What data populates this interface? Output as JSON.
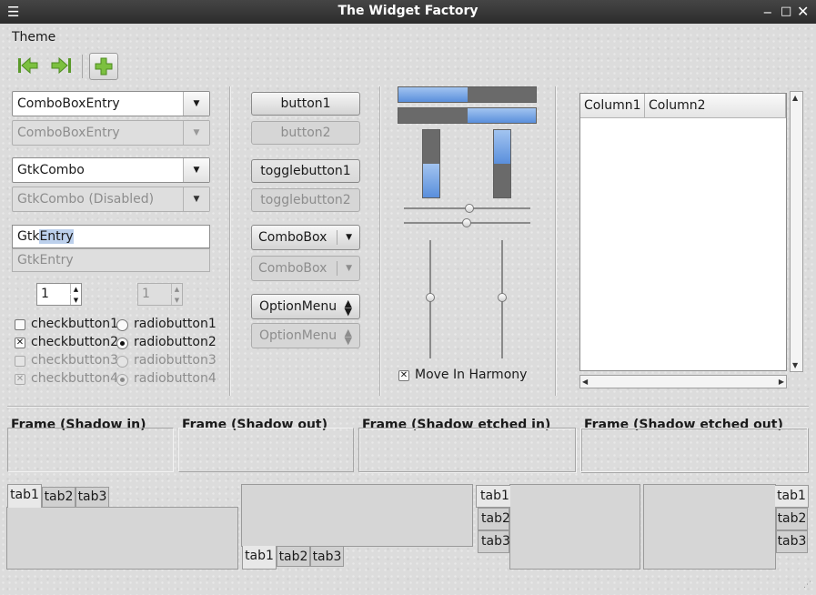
{
  "window": {
    "title": "The Widget Factory"
  },
  "menubar": {
    "theme": "Theme"
  },
  "toolbar": {
    "back_icon": "go-first-icon",
    "forward_icon": "go-last-icon",
    "add_icon": "add-icon"
  },
  "col1": {
    "combo_entry_1": "ComboBoxEntry",
    "combo_entry_2": "ComboBoxEntry",
    "gtk_combo_1": "GtkCombo",
    "gtk_combo_2": "GtkCombo (Disabled)",
    "entry_1_pre": "Gtk",
    "entry_1_sel": "Entry",
    "entry_2": "GtkEntry",
    "spin_1": "1",
    "spin_2": "1",
    "check_1": "checkbutton1",
    "check_2": "checkbutton2",
    "check_3": "checkbutton3",
    "check_4": "checkbutton4",
    "radio_1": "radiobutton1",
    "radio_2": "radiobutton2",
    "radio_3": "radiobutton3",
    "radio_4": "radiobutton4"
  },
  "col2": {
    "button_1": "button1",
    "button_2": "button2",
    "toggle_1": "togglebutton1",
    "toggle_2": "togglebutton2",
    "combobox_1": "ComboBox",
    "combobox_2": "ComboBox",
    "optionmenu_1": "OptionMenu",
    "optionmenu_2": "OptionMenu"
  },
  "col3": {
    "progress_h1": 0.5,
    "progress_h2": 0.5,
    "progress_v1": 0.5,
    "progress_v2": 0.5,
    "harmony_label": "Move In Harmony"
  },
  "tree": {
    "columns": [
      "Column1",
      "Column2"
    ]
  },
  "frames": {
    "shadow_in": "Frame (Shadow in)",
    "shadow_out": "Frame (Shadow out)",
    "etched_in": "Frame (Shadow etched in)",
    "etched_out": "Frame (Shadow etched out)"
  },
  "notebooks": {
    "top_tabs": [
      "tab1",
      "tab2",
      "tab3"
    ],
    "bottom_tabs": [
      "tab1",
      "tab2",
      "tab3"
    ],
    "left_tabs": [
      "tab1",
      "tab2",
      "tab3"
    ],
    "right_tabs": [
      "tab1",
      "tab2",
      "tab3"
    ]
  }
}
